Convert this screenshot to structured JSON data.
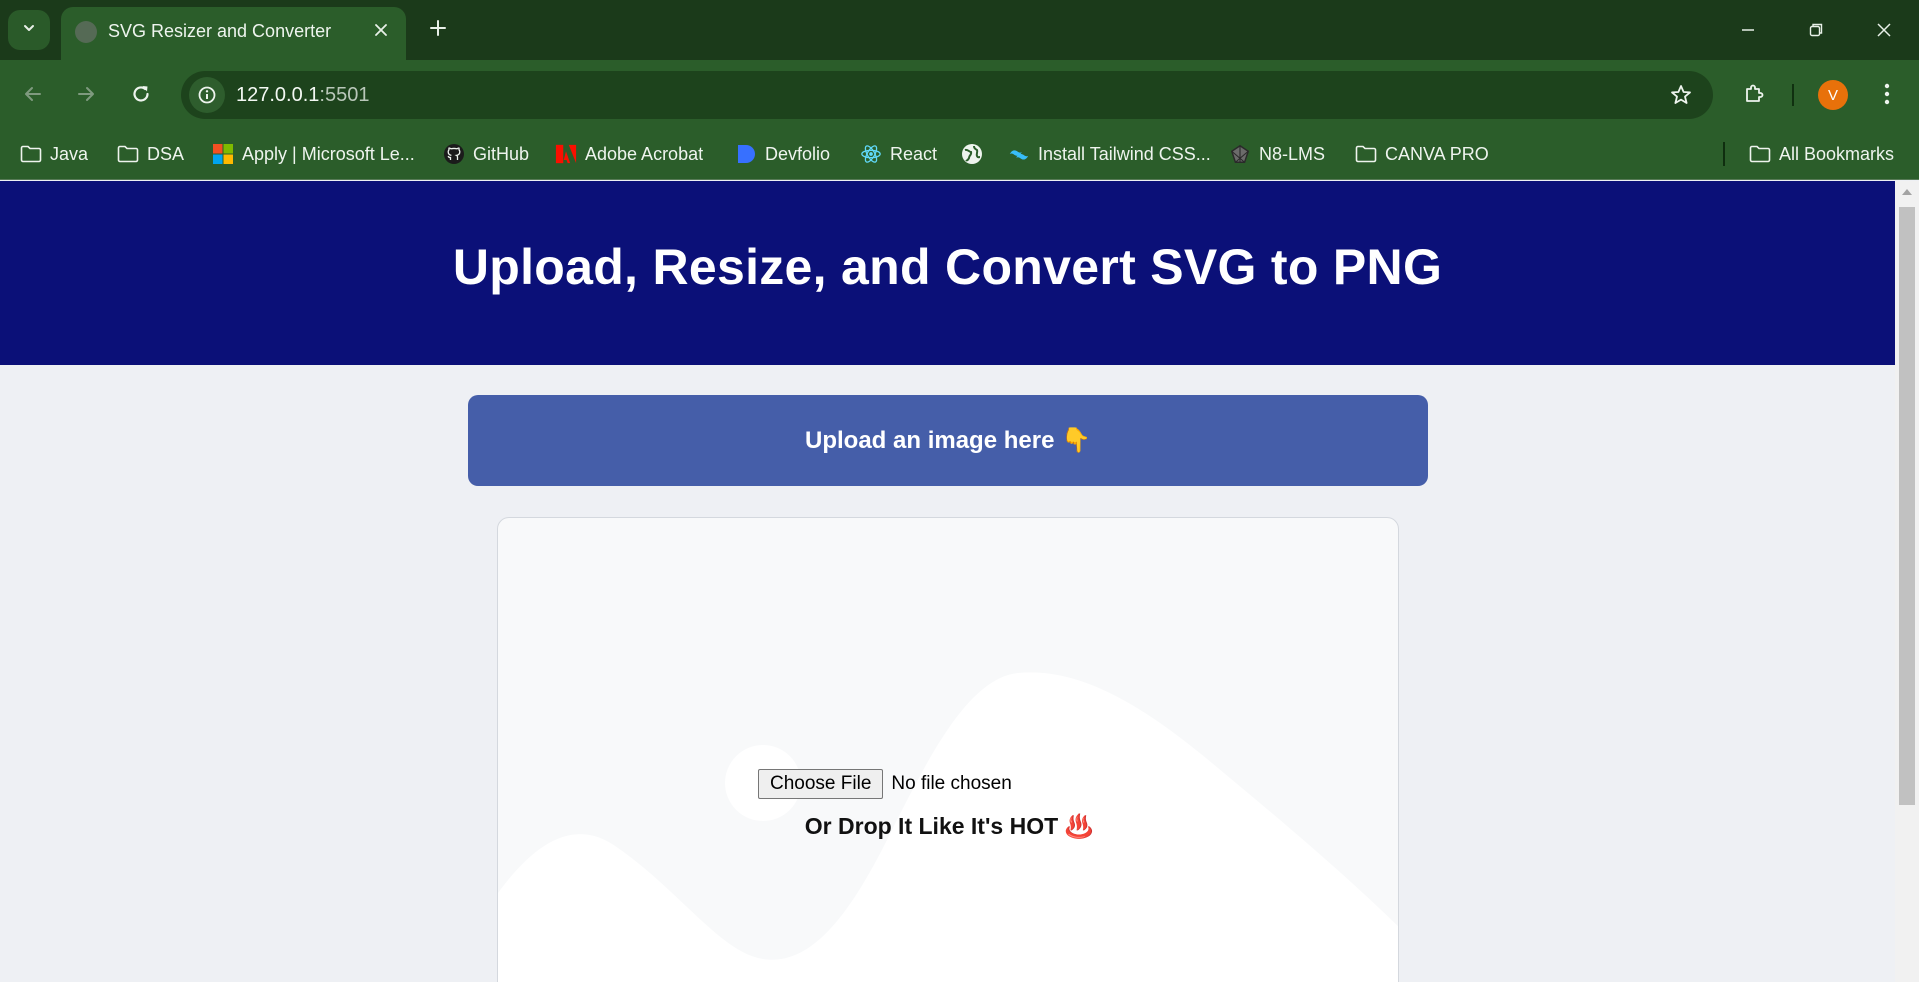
{
  "browser": {
    "tab": {
      "title": "SVG Resizer and Converter"
    },
    "url": {
      "host": "127.0.0.1",
      "port": ":5501"
    },
    "profile_initial": "V",
    "bookmarks": [
      {
        "label": "Java",
        "icon": "folder-icon"
      },
      {
        "label": "DSA",
        "icon": "folder-icon"
      },
      {
        "label": "Apply | Microsoft Le...",
        "icon": "microsoft-icon"
      },
      {
        "label": "GitHub",
        "icon": "github-icon"
      },
      {
        "label": "Adobe Acrobat",
        "icon": "adobe-icon"
      },
      {
        "label": "Devfolio",
        "icon": "devfolio-icon"
      },
      {
        "label": "React",
        "icon": "react-icon"
      },
      {
        "label": "",
        "icon": "globe-icon"
      },
      {
        "label": "Install Tailwind CSS...",
        "icon": "tailwind-icon"
      },
      {
        "label": "N8-LMS",
        "icon": "n8-icon"
      },
      {
        "label": "CANVA PRO",
        "icon": "folder-icon"
      }
    ],
    "all_bookmarks": "All Bookmarks"
  },
  "page": {
    "heading": "Upload, Resize, and Convert SVG to PNG",
    "upload_label": "Upload an image here 👇",
    "file_input": {
      "button": "Choose File",
      "status": "No file chosen"
    },
    "drop_text": "Or Drop It Like It's HOT ♨️"
  },
  "colors": {
    "browser_frame": "#1b3a1a",
    "toolbar": "#2b5d2a",
    "hero": "#0b1078",
    "upload_button": "#455ea9",
    "page_bg": "#eef0f4",
    "avatar": "#e8710a"
  }
}
